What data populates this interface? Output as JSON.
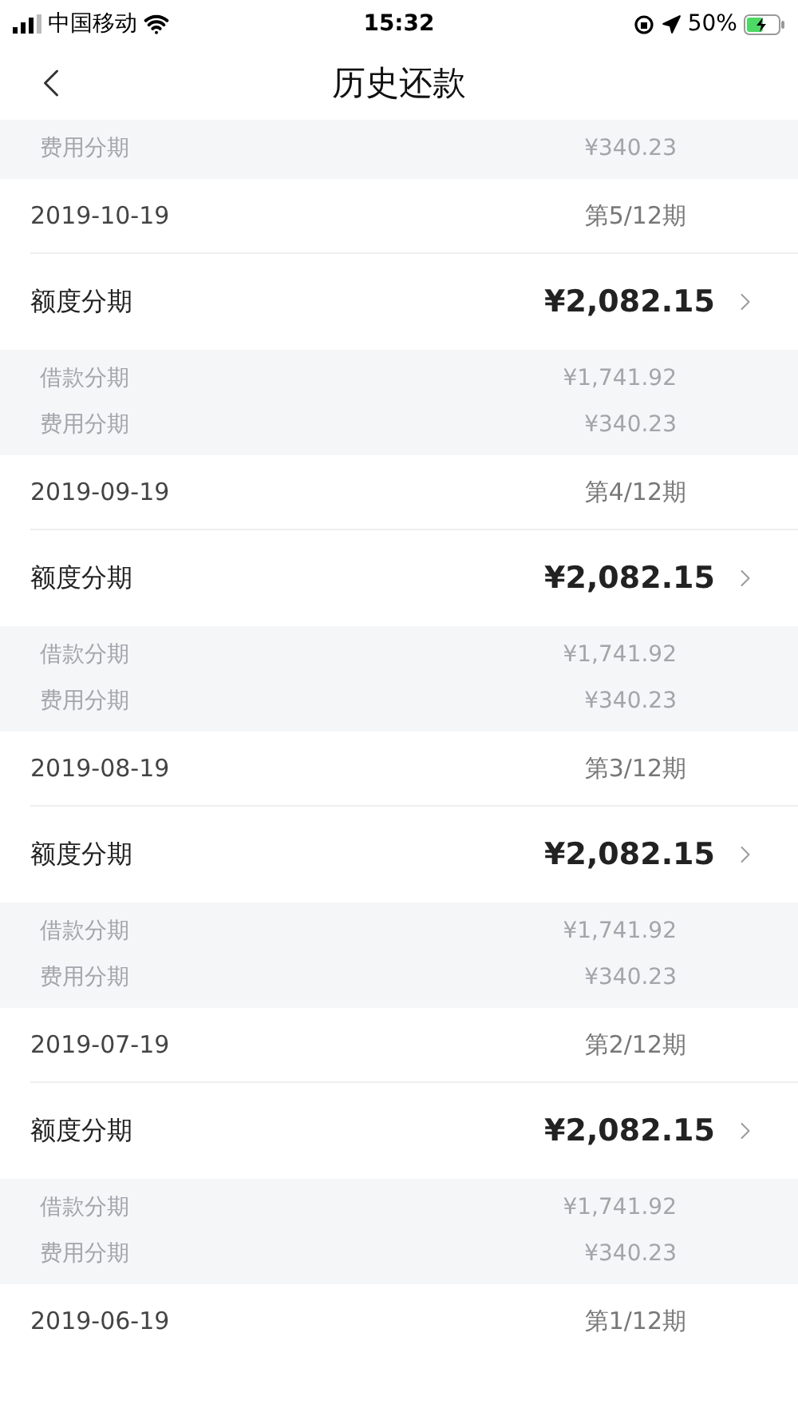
{
  "status_bar": {
    "carrier": "中国移动",
    "time": "15:32",
    "battery": "50%"
  },
  "nav": {
    "title": "历史还款"
  },
  "leading_details": [
    {
      "label": "费用分期",
      "amount": "¥340.23"
    }
  ],
  "records": [
    {
      "date": "2019-10-19",
      "period": "第5/12期",
      "title": "额度分期",
      "amount": "¥2,082.15",
      "details": [
        {
          "label": "借款分期",
          "amount": "¥1,741.92"
        },
        {
          "label": "费用分期",
          "amount": "¥340.23"
        }
      ]
    },
    {
      "date": "2019-09-19",
      "period": "第4/12期",
      "title": "额度分期",
      "amount": "¥2,082.15",
      "details": [
        {
          "label": "借款分期",
          "amount": "¥1,741.92"
        },
        {
          "label": "费用分期",
          "amount": "¥340.23"
        }
      ]
    },
    {
      "date": "2019-08-19",
      "period": "第3/12期",
      "title": "额度分期",
      "amount": "¥2,082.15",
      "details": [
        {
          "label": "借款分期",
          "amount": "¥1,741.92"
        },
        {
          "label": "费用分期",
          "amount": "¥340.23"
        }
      ]
    },
    {
      "date": "2019-07-19",
      "period": "第2/12期",
      "title": "额度分期",
      "amount": "¥2,082.15",
      "details": [
        {
          "label": "借款分期",
          "amount": "¥1,741.92"
        },
        {
          "label": "费用分期",
          "amount": "¥340.23"
        }
      ]
    },
    {
      "date": "2019-06-19",
      "period": "第1/12期"
    }
  ]
}
